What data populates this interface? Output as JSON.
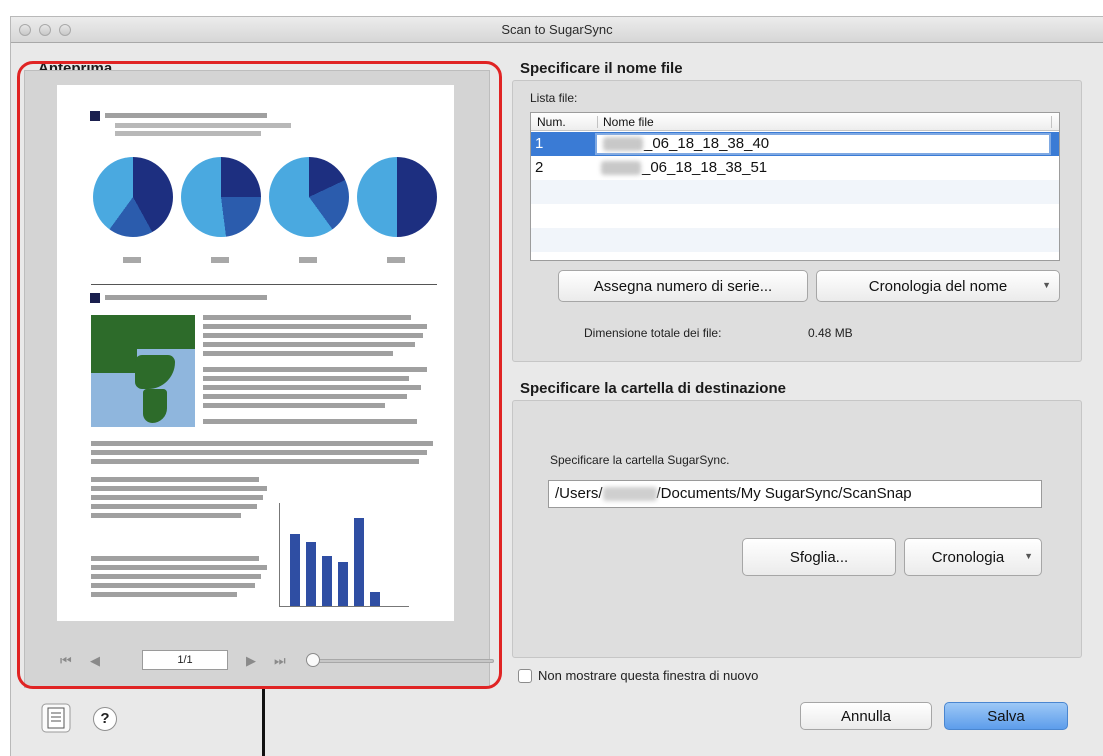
{
  "window": {
    "title": "Scan to SugarSync"
  },
  "preview": {
    "label": "Anteprima",
    "page_indicator": "1/1",
    "zoom_level": 0.05,
    "nav": {
      "first": "⏮",
      "prev": "◀",
      "next": "▶",
      "last": "⏭"
    }
  },
  "file_name_section": {
    "label": "Specificare il nome file",
    "list_label": "Lista file:",
    "columns": [
      "Num.",
      "Nome file"
    ],
    "rows": [
      {
        "num": "1",
        "name": "_06_18_18_38_40",
        "selected": true
      },
      {
        "num": "2",
        "name": "_06_18_18_38_51",
        "selected": false
      }
    ],
    "serial_button": "Assegna numero di serie...",
    "history_button": "Cronologia del nome",
    "total_size_label": "Dimensione totale dei file:",
    "total_size_value": "0.48  MB"
  },
  "destination_section": {
    "label": "Specificare la cartella di destinazione",
    "folder_label": "Specificare la cartella SugarSync.",
    "path_prefix": "/Users/",
    "path_suffix": "/Documents/My SugarSync/ScanSnap",
    "browse_button": "Sfoglia...",
    "history_button": "Cronologia"
  },
  "footer": {
    "dont_show_again": "Non mostrare questa finestra di nuovo",
    "dont_show_again_checked": false,
    "cancel_button": "Annulla",
    "save_button": "Salva",
    "help": "?"
  },
  "colors": {
    "accent": "#3a7bd5",
    "highlight_outline": "#e02424",
    "save_button": "#5d9deb"
  }
}
